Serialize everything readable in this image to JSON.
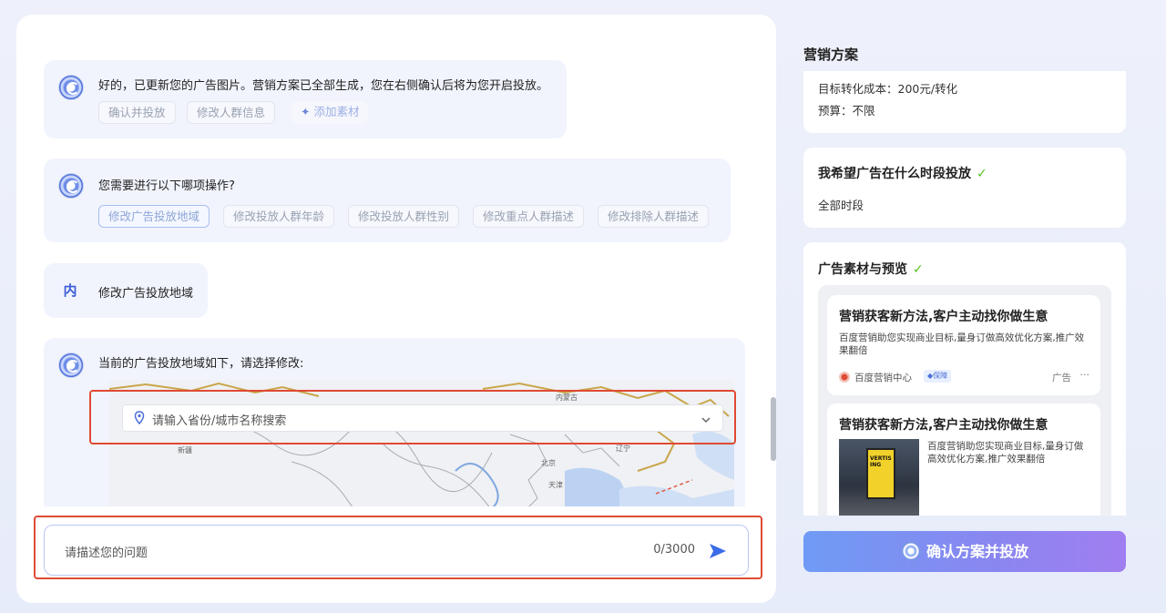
{
  "chat": {
    "msg1": {
      "text": "好的，已更新您的广告图片。营销方案已全部生成，您在右侧确认后将为您开启投放。",
      "chips": [
        "确认并投放",
        "修改人群信息",
        "添加素材"
      ]
    },
    "msg2": {
      "text": "您需要进行以下哪项操作?",
      "chips": [
        "修改广告投放地域",
        "修改投放人群年龄",
        "修改投放人群性别",
        "修改重点人群描述",
        "修改排除人群描述"
      ]
    },
    "user_msg": {
      "avatar_label": "内",
      "text": "修改广告投放地域"
    },
    "msg3": {
      "text": "当前的广告投放地域如下，请选择修改:",
      "map_search_placeholder": "请输入省份/城市名称搜索",
      "map_labels": [
        "内蒙古",
        "新疆",
        "北京",
        "天津",
        "辽宁"
      ]
    }
  },
  "input": {
    "placeholder": "请描述您的问题",
    "counter": "0/3000"
  },
  "right": {
    "title": "营销方案",
    "cost_line": "目标转化成本：200元/转化",
    "budget_line": "预算：不限",
    "time_title": "我希望广告在什么时段投放",
    "time_value": "全部时段",
    "material_title": "广告素材与预览",
    "ad1": {
      "headline": "营销获客新方法,客户主动找你做生意",
      "desc": "百度营销助您实现商业目标,量身订做高效优化方案,推广效果翻倍",
      "brand": "百度营销中心",
      "badge": "保障",
      "ad_tag": "广告",
      "more": "···"
    },
    "ad2": {
      "headline": "营销获客新方法,客户主动找你做生意",
      "desc": "百度营销助您实现商业目标,量身订做高效优化方案,推广效果翻倍",
      "poster_text": "VERTISING"
    },
    "confirm_button": "确认方案并投放"
  },
  "colors": {
    "accent": "#3b5bd6",
    "highlight_border": "#e04a33",
    "check": "#52c41a"
  }
}
